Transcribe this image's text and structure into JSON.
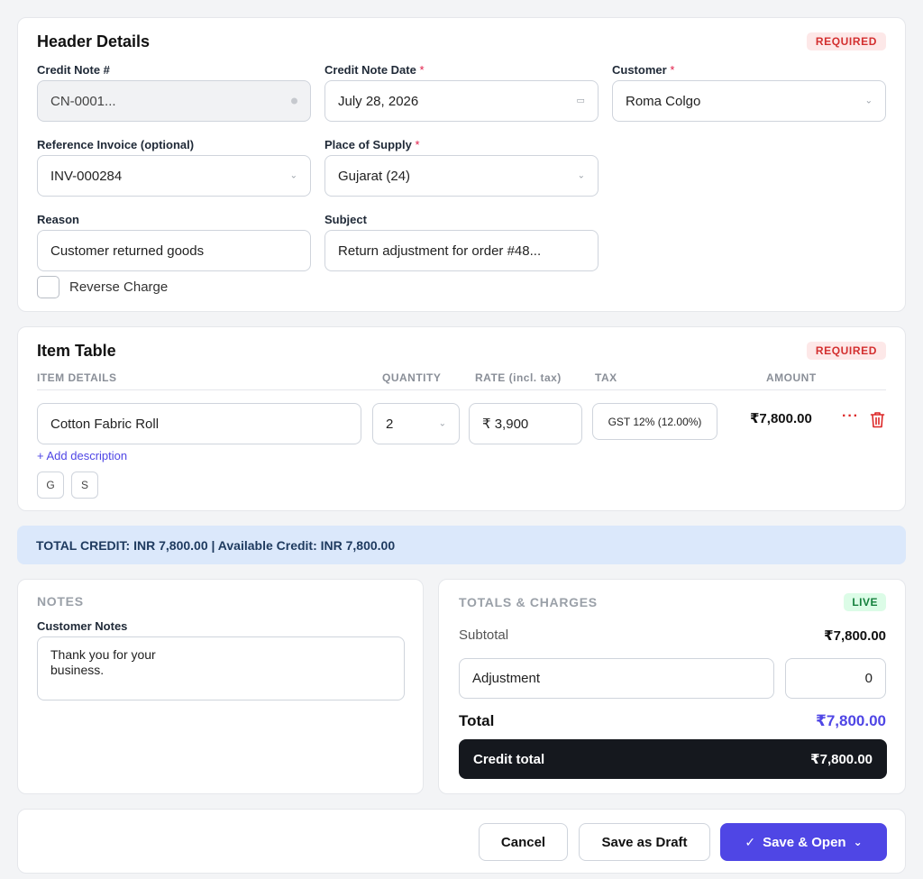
{
  "header": {
    "title": "Header Details",
    "badge": "REQUIRED",
    "credit_note_no": {
      "label": "Credit Note #",
      "value": "CN-0001..."
    },
    "credit_note_date": {
      "label": "Credit Note Date",
      "required_mark": "*",
      "value": "July 28, 2026"
    },
    "customer": {
      "label": "Customer",
      "required_mark": "*",
      "value": "Roma Colgo"
    },
    "reference_invoice": {
      "label": "Reference Invoice (optional)",
      "value": "INV-000284"
    },
    "place_of_supply": {
      "label": "Place of Supply",
      "required_mark": "*",
      "value": "Gujarat (24)"
    },
    "reason": {
      "label": "Reason",
      "value": "Customer returned goods"
    },
    "subject": {
      "label": "Subject",
      "value": "Return adjustment for order #48..."
    },
    "reverse_charge": {
      "label": "Reverse Charge",
      "checked": false
    }
  },
  "items": {
    "title": "Item Table",
    "badge": "REQUIRED",
    "columns": [
      "ITEM DETAILS",
      "QUANTITY",
      "RATE (incl. tax)",
      "TAX",
      "AMOUNT"
    ],
    "rows": [
      {
        "name": "Cotton Fabric Roll",
        "quantity": "2",
        "rate": "₹ 3,900",
        "tax": "GST 12% (12.00%)",
        "amount": "₹7,800.00"
      }
    ],
    "add_description": "+ Add description",
    "tags": [
      "G",
      "S"
    ]
  },
  "total_banner": "TOTAL CREDIT: INR 7,800.00 | Available Credit: INR 7,800.00",
  "notes": {
    "title": "NOTES",
    "label": "Customer Notes",
    "value": "Thank you for your\nbusiness."
  },
  "totals": {
    "title": "TOTALS & CHARGES",
    "badge": "LIVE",
    "subtotal_label": "Subtotal",
    "subtotal_value": "₹7,800.00",
    "adjustment_label": "Adjustment",
    "adjustment_value": "0",
    "total_label": "Total",
    "total_value": "₹7,800.00",
    "credit_total_label": "Credit total",
    "credit_total_value": "₹7,800.00"
  },
  "footer": {
    "cancel": "Cancel",
    "save_draft": "Save as Draft",
    "save_open": "Save & Open"
  },
  "colors": {
    "accent": "#4f46e5",
    "danger": "#dc2626",
    "live": "#15803d",
    "banner": "#dbe8fb",
    "dark": "#15181e"
  }
}
